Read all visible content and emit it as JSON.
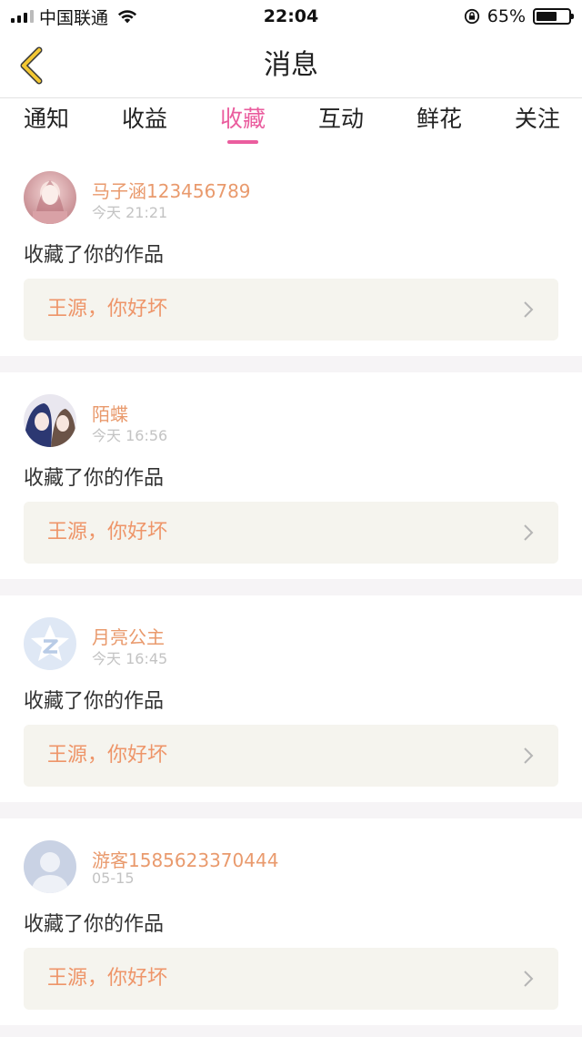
{
  "status_bar": {
    "carrier": "中国联通",
    "time": "22:04",
    "battery_percent": "65%",
    "battery_level": 0.65
  },
  "nav": {
    "title": "消息",
    "back_icon": "chevron-left-icon",
    "back_color": "#f3c733"
  },
  "tabs": [
    {
      "label": "通知",
      "active": false
    },
    {
      "label": "收益",
      "active": false
    },
    {
      "label": "收藏",
      "active": true
    },
    {
      "label": "互动",
      "active": false
    },
    {
      "label": "鲜花",
      "active": false
    },
    {
      "label": "关注",
      "active": false
    }
  ],
  "colors": {
    "accent": "#ea5d9e",
    "username": "#e99a6d",
    "work_title": "#ee9569",
    "timestamp": "#c3c3c3",
    "work_box_bg": "#f5f4ee"
  },
  "messages": [
    {
      "username": "马子涵123456789",
      "time": "今天 21:21",
      "action": "收藏了你的作品",
      "work_title": "王源，你好坏",
      "avatar": "anime-girl-avatar"
    },
    {
      "username": "陌蝶",
      "time": "今天 16:56",
      "action": "收藏了你的作品",
      "work_title": "王源，你好坏",
      "avatar": "anime-pair-avatar"
    },
    {
      "username": "月亮公主",
      "time": "今天 16:45",
      "action": "收藏了你的作品",
      "work_title": "王源，你好坏",
      "avatar": "qzone-avatar"
    },
    {
      "username": "游客1585623370444",
      "time": "05-15",
      "action": "收藏了你的作品",
      "work_title": "王源，你好坏",
      "avatar": "default-user-avatar"
    }
  ]
}
